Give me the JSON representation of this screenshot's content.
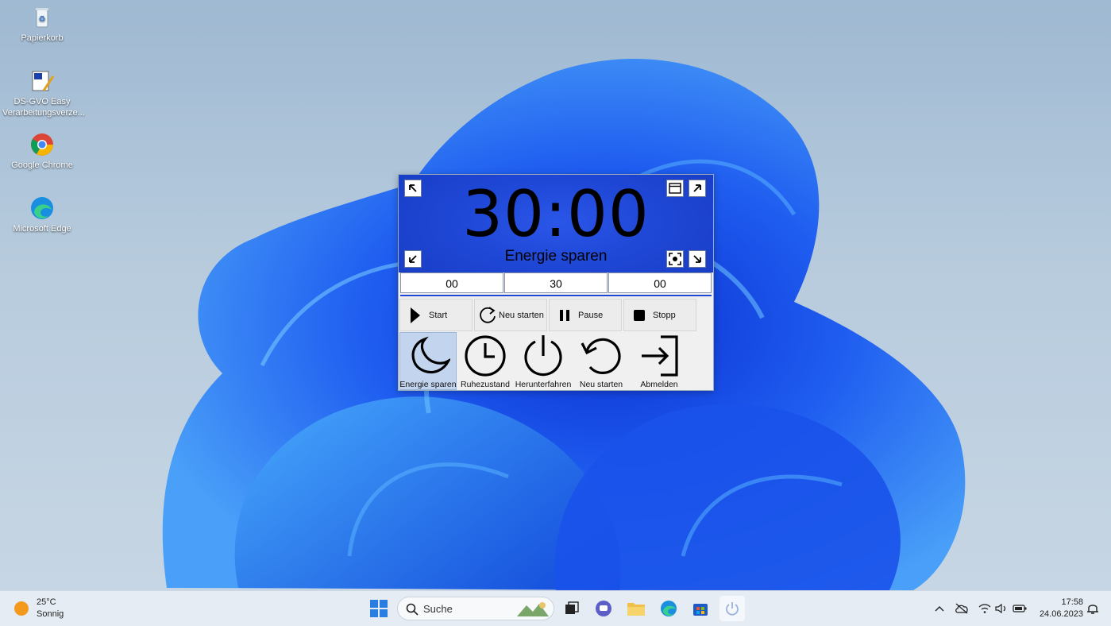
{
  "desktop": {
    "icons": [
      {
        "label": "Papierkorb",
        "icon": "recycle-bin-icon"
      },
      {
        "label": "DS-GVO Easy Verarbeitungsverze...",
        "icon": "ds-gvo-app-icon"
      },
      {
        "label": "Google Chrome",
        "icon": "chrome-icon"
      },
      {
        "label": "Microsoft Edge",
        "icon": "edge-icon"
      }
    ]
  },
  "app": {
    "time": "30:00",
    "mode": "Energie sparen",
    "inputs": {
      "hours": "00",
      "minutes": "30",
      "seconds": "00"
    },
    "controls": {
      "start": "Start",
      "restart": "Neu starten",
      "pause": "Pause",
      "stop": "Stopp"
    },
    "actions": [
      {
        "label": "Energie sparen",
        "icon": "moon-icon",
        "selected": true
      },
      {
        "label": "Ruhezustand",
        "icon": "clock-icon",
        "selected": false
      },
      {
        "label": "Herunterfahren",
        "icon": "power-icon",
        "selected": false
      },
      {
        "label": "Neu starten",
        "icon": "restart-icon",
        "selected": false
      },
      {
        "label": "Abmelden",
        "icon": "logout-icon",
        "selected": false
      }
    ],
    "accent_color": "#1f47d6"
  },
  "taskbar": {
    "weather": {
      "temp": "25°C",
      "condition": "Sonnig"
    },
    "search_placeholder": "Suche",
    "clock": {
      "time": "17:58",
      "date": "24.06.2023"
    }
  }
}
